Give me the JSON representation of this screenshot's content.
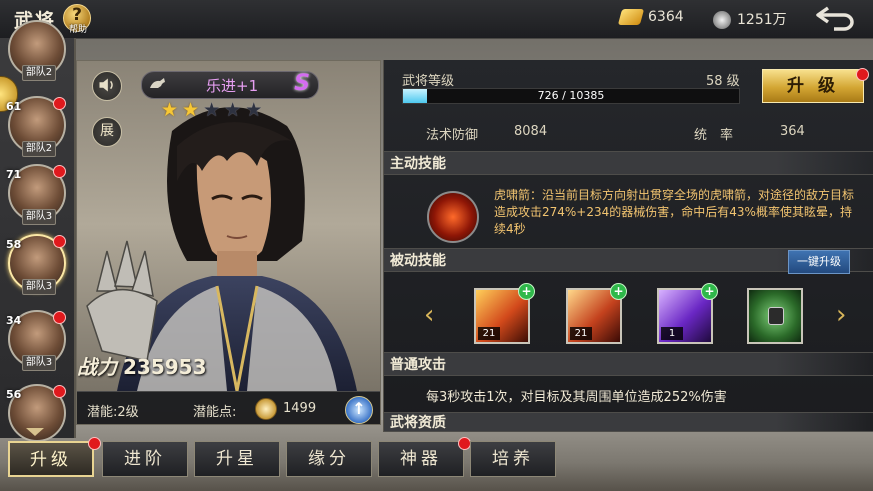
{
  "header": {
    "title": "武将",
    "help_label": "帮助",
    "gold": "6364",
    "silver": "1251万"
  },
  "roster": [
    {
      "level": "",
      "team": "部队2",
      "alert": false,
      "selected": false
    },
    {
      "level": "61",
      "team": "部队2",
      "alert": true,
      "selected": false
    },
    {
      "level": "71",
      "team": "部队3",
      "alert": true,
      "selected": false
    },
    {
      "level": "58",
      "team": "部队3",
      "alert": true,
      "selected": true
    },
    {
      "level": "34",
      "team": "部队3",
      "alert": true,
      "selected": false
    },
    {
      "level": "56",
      "team": "",
      "alert": true,
      "selected": false
    }
  ],
  "character": {
    "name": "乐进+1",
    "rank": "S",
    "stars_filled": 2,
    "stars_total": 5,
    "zhan_label": "展",
    "power_label": "战力",
    "power_value": "235953",
    "potential_level": "潜能:2级",
    "potential_points_label": "潜能点:",
    "potential_points": "1499"
  },
  "info": {
    "level_label": "武将等级",
    "level_value": "58 级",
    "exp_text": "726 / 10385",
    "exp_fraction": 0.07,
    "upgrade_label": "升 级",
    "magic_def_label": "法术防御",
    "magic_def_value": "8084",
    "command_label": "统　率",
    "command_value": "364",
    "active_skill_title": "主动技能",
    "active_skill_desc": "虎啸箭：沿当前目标方向射出贯穿全场的虎啸箭，对途径的敌方目标造成攻击274%+234的器械伤害，命中后有43%概率使其眩晕，持续4秒",
    "passive_skill_title": "被动技能",
    "onekey_label": "一键升级",
    "passive_skills": [
      {
        "count": "21",
        "icon": "fire-warrior-icon",
        "upgradeable": true,
        "locked": false
      },
      {
        "count": "21",
        "icon": "fist-icon",
        "upgradeable": true,
        "locked": false
      },
      {
        "count": "1",
        "icon": "purple-slash-icon",
        "upgradeable": true,
        "locked": false
      },
      {
        "count": "",
        "icon": "lock-icon",
        "upgradeable": false,
        "locked": true
      }
    ],
    "normal_attack_title": "普通攻击",
    "normal_attack_desc": "每3秒攻击1次，对目标及其周围单位造成252%伤害",
    "next_section_title": "武将资质"
  },
  "tabs": [
    {
      "label": "升级",
      "active": true,
      "alert": true
    },
    {
      "label": "进阶",
      "active": false,
      "alert": false
    },
    {
      "label": "升星",
      "active": false,
      "alert": false
    },
    {
      "label": "缘分",
      "active": false,
      "alert": false
    },
    {
      "label": "神器",
      "active": false,
      "alert": true
    },
    {
      "label": "培养",
      "active": false,
      "alert": false
    }
  ],
  "colors": {
    "accent_gold": "#d3a633",
    "skill_text": "#f2c470",
    "alert_red": "#e0191d",
    "rank_purple": "#d46cf0"
  }
}
